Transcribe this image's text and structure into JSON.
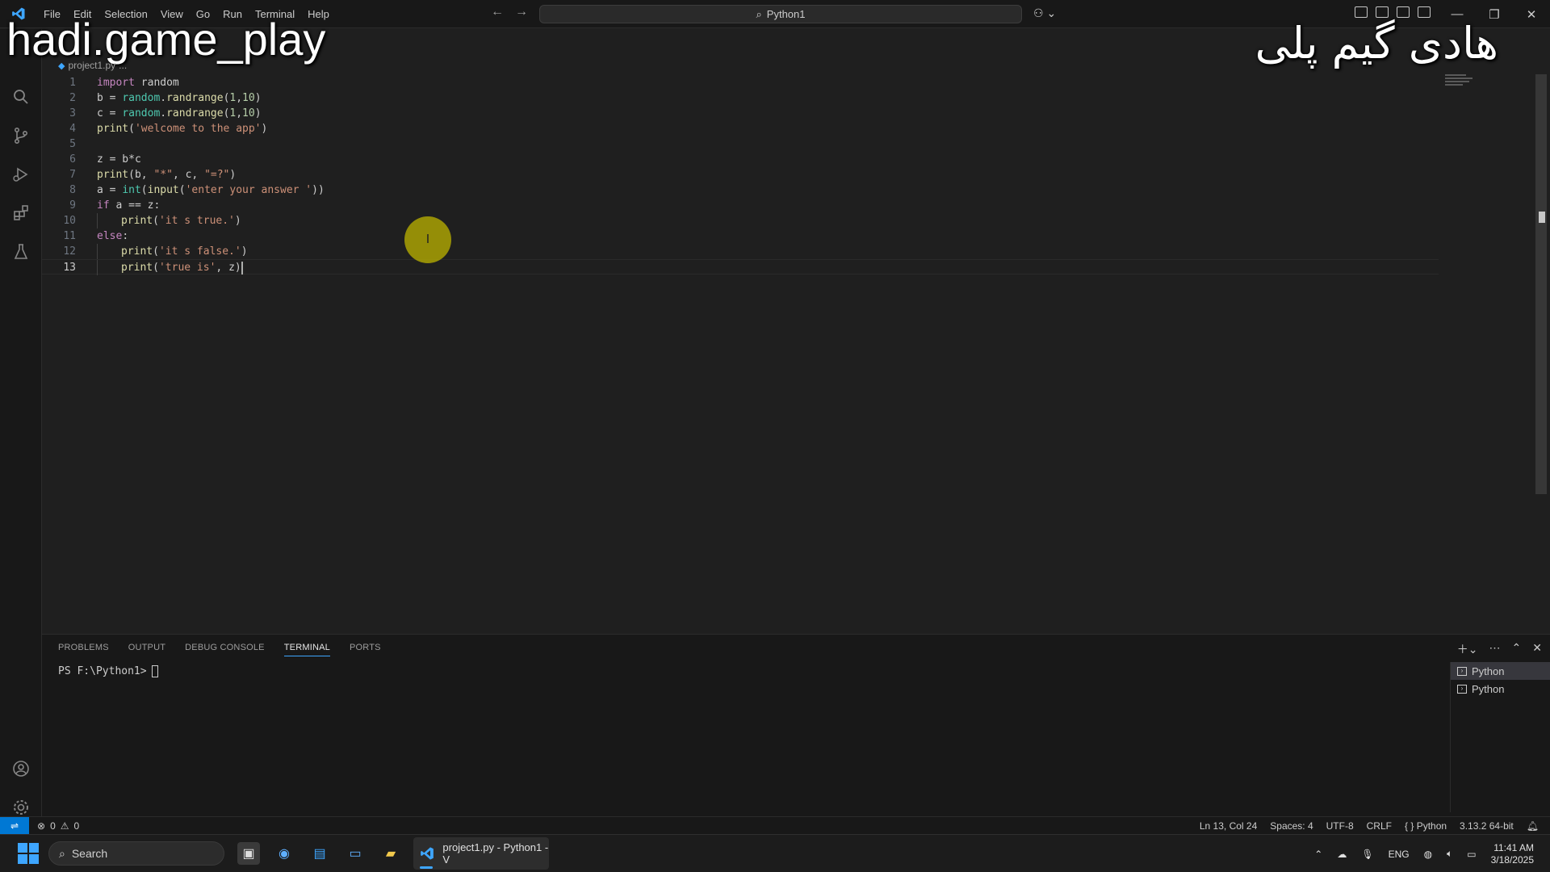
{
  "window": {
    "menu": [
      "File",
      "Edit",
      "Selection",
      "View",
      "Go",
      "Run",
      "Terminal",
      "Help"
    ],
    "command_center": "Python1"
  },
  "overlay": {
    "left_text": "hadi.game_play",
    "right_text": "هادی گیم پلی"
  },
  "breadcrumb": {
    "file": "project1.py",
    "more": "..."
  },
  "code": {
    "lines": [
      "1",
      "2",
      "3",
      "4",
      "5",
      "6",
      "7",
      "8",
      "9",
      "10",
      "11",
      "12",
      "13"
    ],
    "text": {
      "l1a": "import",
      "l1b": " random",
      "l2a": "b = ",
      "l2b": "random",
      "l2c": ".",
      "l2d": "randrange",
      "l2e": "(",
      "l2f": "1",
      "l2g": ",",
      "l2h": "10",
      "l2i": ")",
      "l3a": "c = ",
      "l3b": "random",
      "l3c": ".",
      "l3d": "randrange",
      "l3e": "(",
      "l3f": "1",
      "l3g": ",",
      "l3h": "10",
      "l3i": ")",
      "l4a": "print",
      "l4b": "(",
      "l4c": "'welcome to the app'",
      "l4d": ")",
      "l6a": "z = b*c",
      "l7a": "print",
      "l7b": "(b, ",
      "l7c": "\"*\"",
      "l7d": ", c, ",
      "l7e": "\"=?\"",
      "l7f": ")",
      "l8a": "a = ",
      "l8b": "int",
      "l8c": "(",
      "l8d": "input",
      "l8e": "(",
      "l8f": "'enter your answer '",
      "l8g": "))",
      "l9a": "if",
      "l9b": " a == z:",
      "l10a": "print",
      "l10b": "(",
      "l10c": "'it s true.'",
      "l10d": ")",
      "l11a": "else",
      "l11b": ":",
      "l12a": "print",
      "l12b": "(",
      "l12c": "'it s false.'",
      "l12d": ")",
      "l13a": "print",
      "l13b": "(",
      "l13c": "'true is'",
      "l13d": ", z",
      "l13e": ")"
    }
  },
  "panel": {
    "tabs": [
      "PROBLEMS",
      "OUTPUT",
      "DEBUG CONSOLE",
      "TERMINAL",
      "PORTS"
    ],
    "active_tab": "TERMINAL",
    "prompt": "PS F:\\Python1>",
    "terminals": [
      "Python",
      "Python"
    ]
  },
  "statusbar": {
    "errors": "0",
    "warnings": "0",
    "position": "Ln 13, Col 24",
    "spaces": "Spaces: 4",
    "encoding": "UTF-8",
    "eol": "CRLF",
    "language": "Python",
    "interpreter": "3.13.2 64-bit"
  },
  "taskbar": {
    "search_placeholder": "Search",
    "active_app": "project1.py - Python1 - V",
    "lang": "ENG",
    "time": "11:41 AM",
    "date": "3/18/2025"
  },
  "colors": {
    "accent": "#0078d4",
    "cursor_highlight": "#bfb400"
  }
}
